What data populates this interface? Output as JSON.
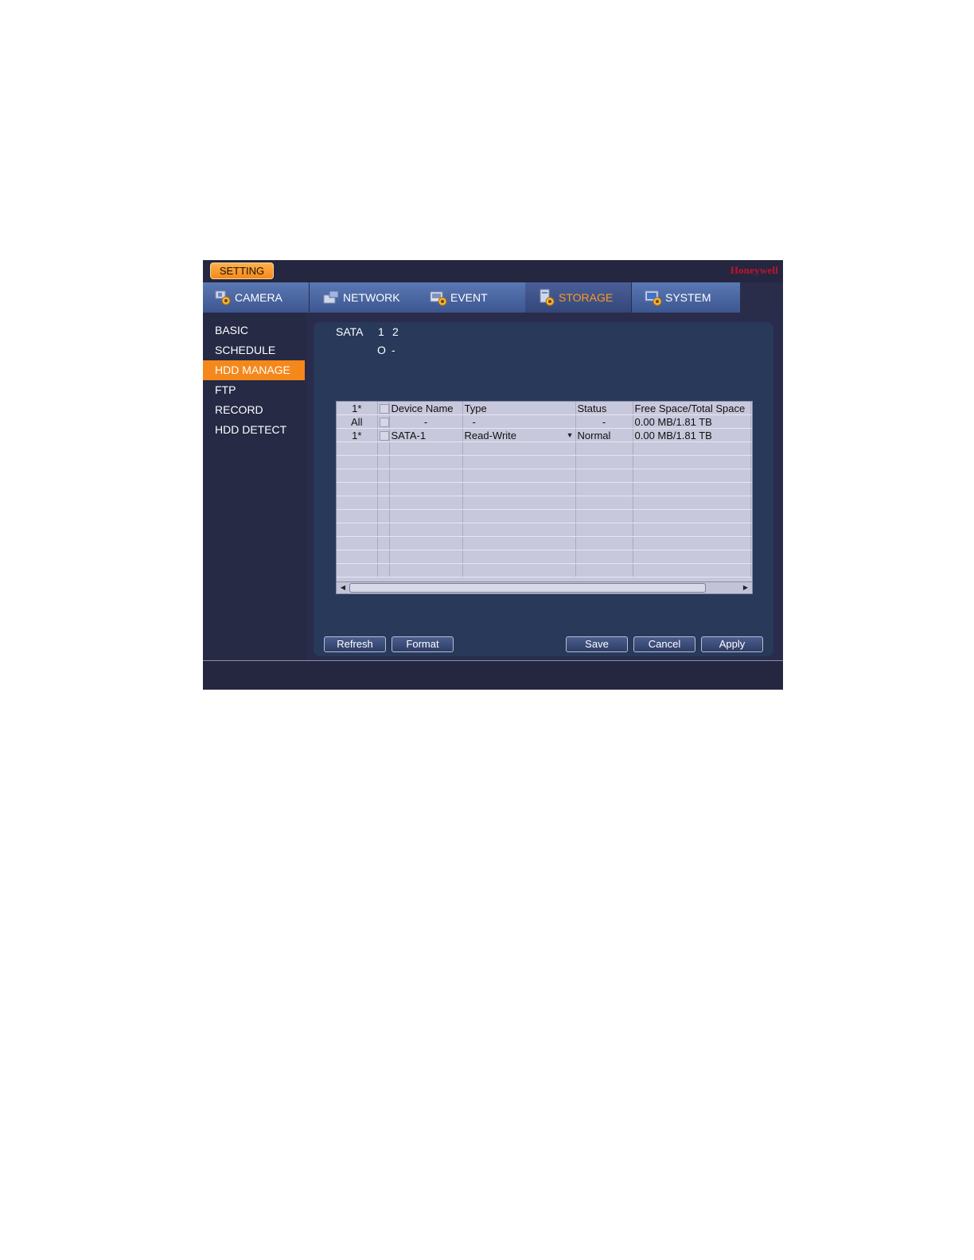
{
  "header": {
    "badge": "SETTING",
    "brand": "Honeywell"
  },
  "tabs": [
    {
      "label": "CAMERA",
      "icon": "camera-settings-icon"
    },
    {
      "label": "NETWORK",
      "icon": "network-settings-icon"
    },
    {
      "label": "EVENT",
      "icon": "event-settings-icon"
    },
    {
      "label": "STORAGE",
      "icon": "storage-settings-icon",
      "active": true
    },
    {
      "label": "SYSTEM",
      "icon": "system-settings-icon"
    }
  ],
  "sidebar": {
    "items": [
      {
        "label": "BASIC"
      },
      {
        "label": "SCHEDULE"
      },
      {
        "label": "HDD MANAGE",
        "active": true
      },
      {
        "label": "FTP"
      },
      {
        "label": "RECORD"
      },
      {
        "label": "HDD DETECT"
      }
    ]
  },
  "sata": {
    "label": "SATA",
    "port1": "1",
    "port2": "2",
    "status1": "O",
    "status2": "-"
  },
  "table": {
    "headers": {
      "num": "1*",
      "device_name": "Device Name",
      "type": "Type",
      "status": "Status",
      "space": "Free Space/Total Space"
    },
    "rows": [
      {
        "num": "All",
        "device_name": "-",
        "type": "-",
        "status": "-",
        "space": "0.00 MB/1.81 TB"
      },
      {
        "num": "1*",
        "device_name": "SATA-1",
        "type": "Read-Write",
        "status": "Normal",
        "space": "0.00 MB/1.81 TB"
      }
    ]
  },
  "buttons": {
    "refresh": "Refresh",
    "format": "Format",
    "save": "Save",
    "cancel": "Cancel",
    "apply": "Apply"
  },
  "colors": {
    "accent": "#f5881a",
    "brand": "#c8102e",
    "background": "#292c4b",
    "panel": "#28395a"
  }
}
